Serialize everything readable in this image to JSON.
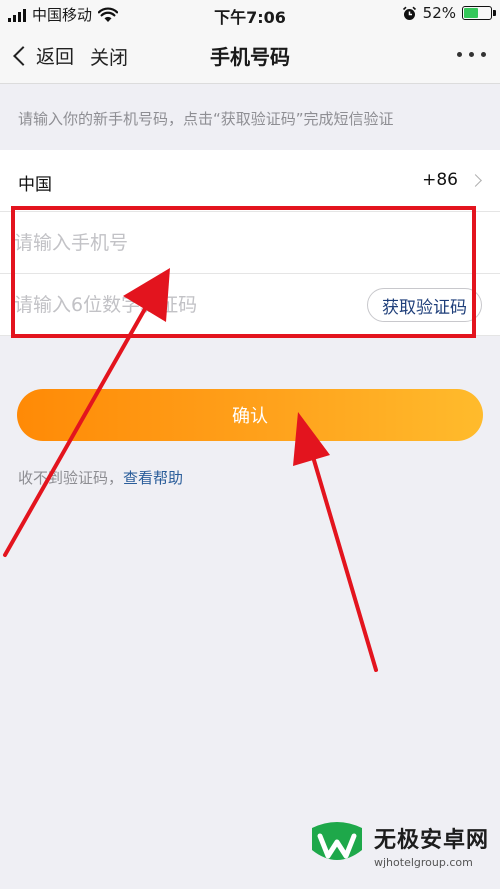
{
  "status_bar": {
    "carrier": "中国移动",
    "time": "下午7:06",
    "battery_percent": "52%",
    "battery_level": 0.52,
    "icons": [
      "signal-icon",
      "wifi-icon",
      "alarm-icon",
      "battery-icon"
    ]
  },
  "nav": {
    "back_label": "返回",
    "close_label": "关闭",
    "title": "手机号码",
    "more_icon": "more-dots-icon"
  },
  "hint": "请输入你的新手机号码，点击“获取验证码”完成短信验证",
  "country": {
    "label": "中国",
    "code": "+86"
  },
  "phone_input": {
    "placeholder": "请输入手机号",
    "value": ""
  },
  "code_input": {
    "placeholder": "请输入6位数字验证码",
    "value": ""
  },
  "get_code_button": "获取验证码",
  "confirm_button": "确认",
  "help": {
    "prefix": "收不到验证码，",
    "link": "查看帮助"
  },
  "watermark": {
    "name": "无极安卓网",
    "url": "wjhotelgroup.com"
  },
  "colors": {
    "accent_orange": "#ff8a06",
    "accent_orange_end": "#ffbb2c",
    "annotation_red": "#e3141e",
    "link_blue": "#2a5d9a",
    "page_bg": "#efeff4"
  }
}
